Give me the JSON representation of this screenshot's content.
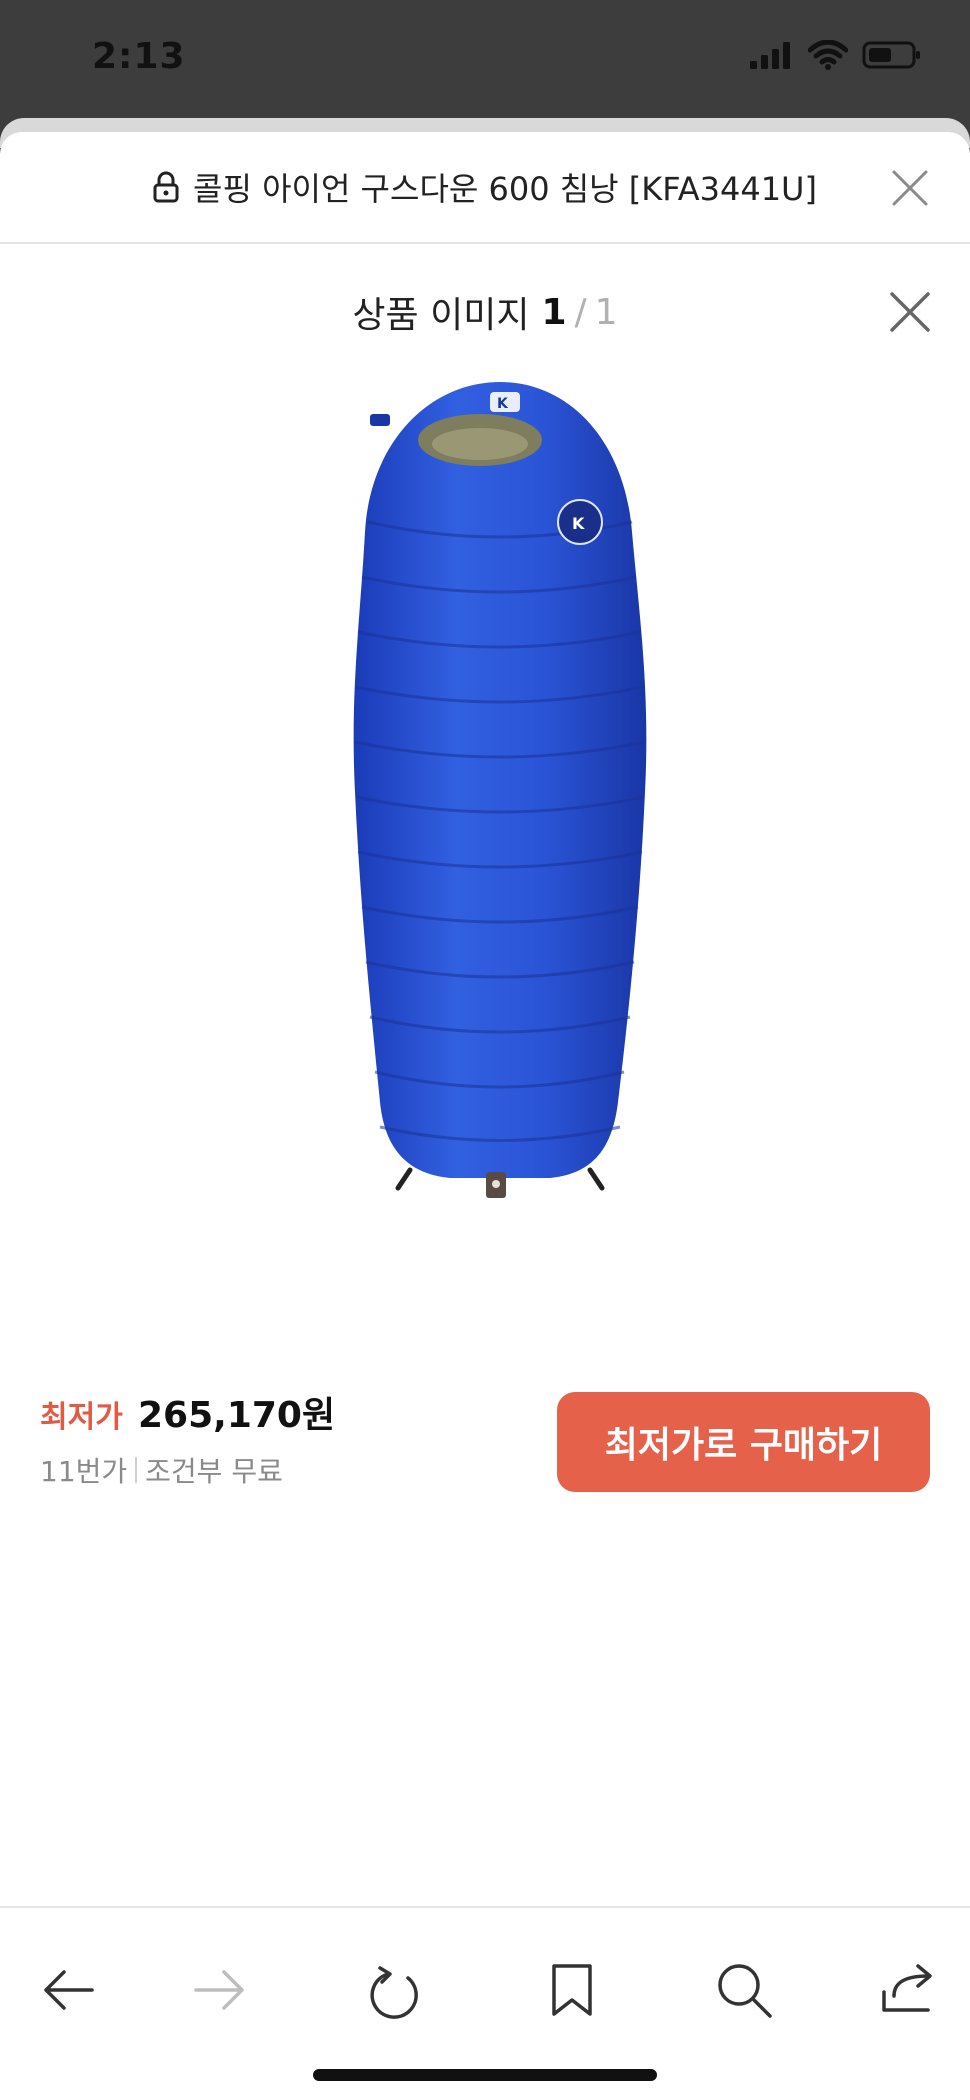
{
  "status_bar": {
    "time": "2:13",
    "icons": [
      "signal-icon",
      "wifi-icon",
      "battery-icon"
    ]
  },
  "url_bar": {
    "title": "콜핑 아이언 구스다운 600 침낭 [KFA3441U]",
    "icons": [
      "lock-icon",
      "close-icon"
    ]
  },
  "viewer": {
    "title": "상품 이미지",
    "current": "1",
    "separator": "/",
    "total": "1",
    "close_icon": "close-icon"
  },
  "product": {
    "image_alt": "blue down sleeping bag",
    "colors": {
      "bag": "#2a4fd0",
      "bag_dark": "#1a37a8",
      "hood_lining": "#8a8a68"
    }
  },
  "purchase": {
    "price_label": "최저가",
    "price": "265,170원",
    "seller": "11번가",
    "shipping": "조건부 무료",
    "buy_label": "최저가로 구매하기"
  },
  "toolbar": {
    "items": [
      "back-icon",
      "forward-icon",
      "reload-icon",
      "bookmark-icon",
      "search-icon",
      "share-icon"
    ]
  },
  "colors": {
    "accent": "#e5614a",
    "price_label": "#e05a44",
    "status_bar_bg": "#3d3d3d"
  }
}
